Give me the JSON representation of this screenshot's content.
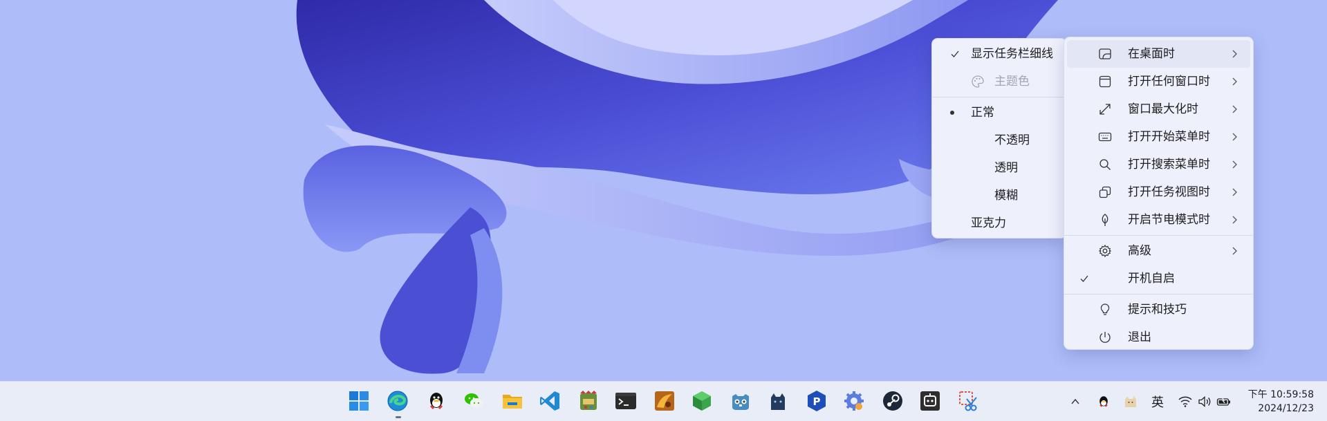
{
  "colors": {
    "wallpaper_bg": "#aebdf9",
    "menu_bg": "#eef1fc",
    "highlight": "#e2e6f5",
    "accent": "#3a46c8"
  },
  "main_menu": {
    "items": [
      {
        "label": "在桌面时",
        "icon": "desktop-icon",
        "submenu": true,
        "highlighted": true
      },
      {
        "label": "打开任何窗口时",
        "icon": "window-icon",
        "submenu": true
      },
      {
        "label": "窗口最大化时",
        "icon": "maximize-icon",
        "submenu": true
      },
      {
        "label": "打开开始菜单时",
        "icon": "keyboard-icon",
        "submenu": true
      },
      {
        "label": "打开搜索菜单时",
        "icon": "search-icon",
        "submenu": true
      },
      {
        "label": "打开任务视图时",
        "icon": "task-view-icon",
        "submenu": true
      },
      {
        "label": "开启节电模式时",
        "icon": "leaf-icon",
        "submenu": true
      },
      {
        "label": "高级",
        "icon": "gear-icon",
        "submenu": true
      },
      {
        "label": "开机自启",
        "checked": true
      },
      {
        "label": "提示和技巧",
        "icon": "lightbulb-icon"
      },
      {
        "label": "退出",
        "icon": "power-icon"
      }
    ]
  },
  "sub_menu": {
    "items": [
      {
        "label": "显示任务栏细线",
        "checked": true
      },
      {
        "label": "主题色",
        "icon": "palette-icon",
        "disabled": true
      },
      {
        "label": "正常",
        "selected": true
      },
      {
        "label": "不透明"
      },
      {
        "label": "透明"
      },
      {
        "label": "模糊"
      },
      {
        "label": "亚克力"
      }
    ]
  },
  "taskbar": {
    "apps": [
      {
        "name": "start-button-icon"
      },
      {
        "name": "edge-icon",
        "running": true
      },
      {
        "name": "qq-icon"
      },
      {
        "name": "wechat-icon"
      },
      {
        "name": "file-explorer-icon"
      },
      {
        "name": "vscode-icon"
      },
      {
        "name": "game-app-icon"
      },
      {
        "name": "terminal-icon"
      },
      {
        "name": "image-app-icon"
      },
      {
        "name": "green-cube-icon"
      },
      {
        "name": "godot-icon"
      },
      {
        "name": "cat-app-icon"
      },
      {
        "name": "p-app-icon"
      },
      {
        "name": "settings-app-icon"
      },
      {
        "name": "steam-icon"
      },
      {
        "name": "bot-app-icon"
      },
      {
        "name": "snipping-tool-icon"
      }
    ],
    "tray": {
      "ime_label": "英",
      "clock_time": "下午 10:59:58",
      "clock_date": "2024/12/23"
    }
  }
}
